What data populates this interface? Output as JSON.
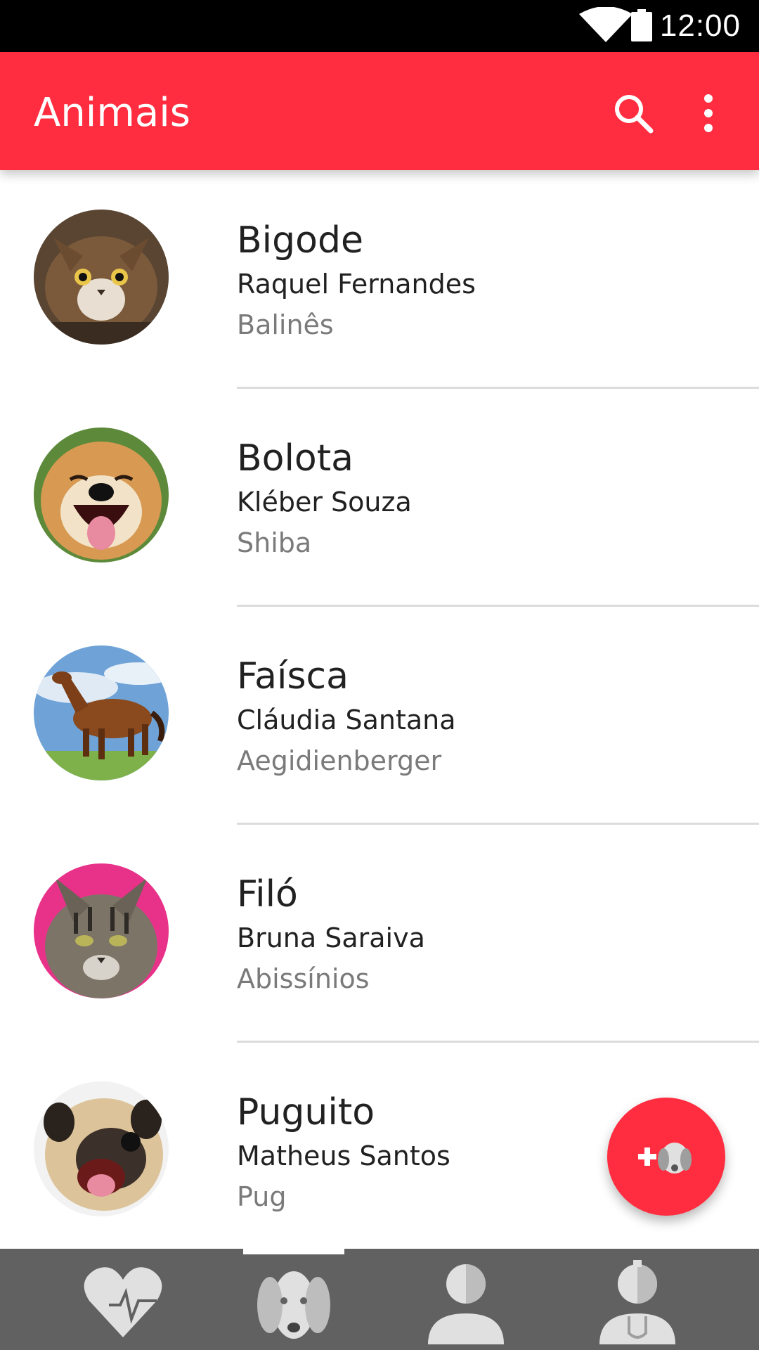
{
  "status_bar": {
    "time": "12:00"
  },
  "app_bar": {
    "title": "Animais",
    "search_icon": "search-icon",
    "more_icon": "more-vert-icon",
    "color": "#ff2d3f"
  },
  "animals": [
    {
      "name": "Bigode",
      "owner": "Raquel Fernandes",
      "breed": "Balinês",
      "avatar": "cat-photo"
    },
    {
      "name": "Bolota",
      "owner": "Kléber Souza",
      "breed": "Shiba",
      "avatar": "shiba-dog-photo"
    },
    {
      "name": "Faísca",
      "owner": "Cláudia Santana",
      "breed": "Aegidienberger",
      "avatar": "horse-photo"
    },
    {
      "name": "Filó",
      "owner": "Bruna Saraiva",
      "breed": "Abissínios",
      "avatar": "tabby-cat-photo"
    },
    {
      "name": "Puguito",
      "owner": "Matheus Santos",
      "breed": "Pug",
      "avatar": "pug-dog-photo"
    }
  ],
  "fab": {
    "icon": "add-pet-icon"
  },
  "bottom_nav": {
    "items": [
      {
        "icon": "heart-pulse-icon",
        "selected": false
      },
      {
        "icon": "dog-icon",
        "selected": true
      },
      {
        "icon": "person-icon",
        "selected": false
      },
      {
        "icon": "veterinarian-icon",
        "selected": false
      }
    ]
  }
}
